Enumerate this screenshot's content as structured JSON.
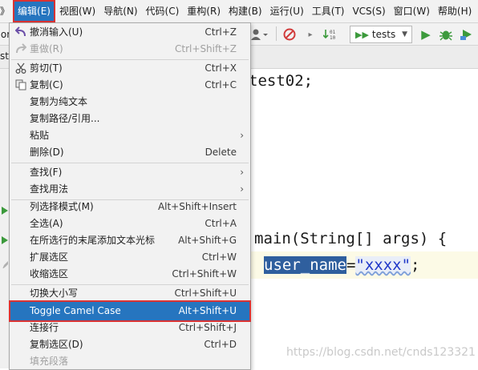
{
  "menubar": {
    "items": [
      "》",
      "编辑(E)",
      "视图(W)",
      "导航(N)",
      "代码(C)",
      "重构(R)",
      "构建(B)",
      "运行(U)",
      "工具(T)",
      "VCS(S)",
      "窗口(W)",
      "帮助(H)"
    ],
    "active": "编辑(E)"
  },
  "toolbar": {
    "run_config": "tests"
  },
  "tabs": {
    "fragment_top": "or",
    "fragment_tab": "st1"
  },
  "editor": {
    "line1": "test02;",
    "line2": "main(String[] args) {",
    "line3_var": "user_name",
    "line3_eq": "=",
    "line3_str": "\"xxxx\"",
    "line3_end": ";"
  },
  "menu": {
    "items": [
      {
        "label": "撤消输入(U)",
        "shortcut": "Ctrl+Z",
        "icon": "undo-icon"
      },
      {
        "label": "重做(R)",
        "shortcut": "Ctrl+Shift+Z",
        "icon": "redo-icon",
        "disabled": true
      },
      {
        "label": "剪切(T)",
        "shortcut": "Ctrl+X",
        "icon": "cut-icon"
      },
      {
        "label": "复制(C)",
        "shortcut": "Ctrl+C",
        "icon": "copy-icon"
      },
      {
        "label": "复制为纯文本",
        "shortcut": ""
      },
      {
        "label": "复制路径/引用...",
        "shortcut": ""
      },
      {
        "label": "粘贴",
        "shortcut": "",
        "submenu": true
      },
      {
        "label": "删除(D)",
        "shortcut": "Delete"
      },
      {
        "label": "查找(F)",
        "shortcut": "",
        "submenu": true
      },
      {
        "label": "查找用法",
        "shortcut": "",
        "submenu": true
      },
      {
        "label": "列选择模式(M)",
        "shortcut": "Alt+Shift+Insert"
      },
      {
        "label": "全选(A)",
        "shortcut": "Ctrl+A"
      },
      {
        "label": "在所选行的末尾添加文本光标",
        "shortcut": "Alt+Shift+G"
      },
      {
        "label": "扩展选区",
        "shortcut": "Ctrl+W"
      },
      {
        "label": "收缩选区",
        "shortcut": "Ctrl+Shift+W"
      },
      {
        "label": "切换大小写",
        "shortcut": "Ctrl+Shift+U"
      },
      {
        "label": "Toggle Camel Case",
        "shortcut": "Alt+Shift+U",
        "highlighted": true
      },
      {
        "label": "连接行",
        "shortcut": "Ctrl+Shift+J"
      },
      {
        "label": "复制选区(D)",
        "shortcut": "Ctrl+D"
      },
      {
        "label": "填充段落",
        "shortcut": "",
        "disabled": true
      }
    ]
  },
  "watermark": "https://blog.csdn.net/cnds123321",
  "colors": {
    "menu_highlight": "#2675bf",
    "callout_border": "#d93333",
    "selection": "#2f5f9e"
  }
}
